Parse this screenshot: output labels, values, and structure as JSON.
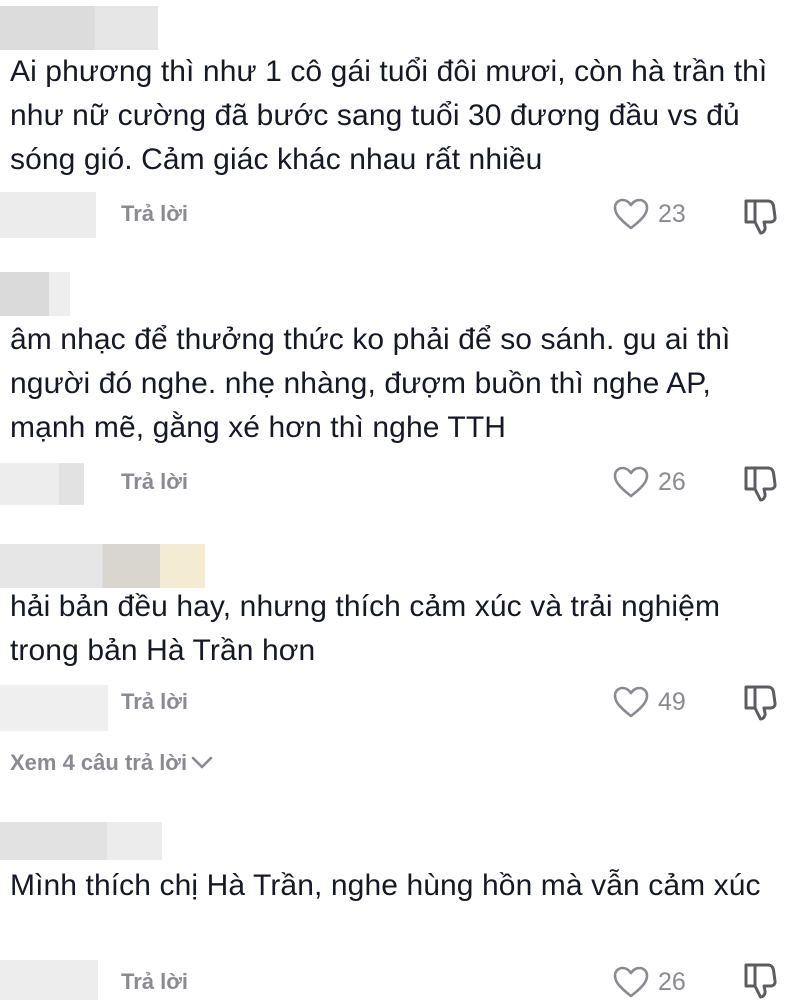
{
  "comments": [
    {
      "text": "Ai phương thì như 1 cô gái tuổi đôi mươi, còn hà trần thì như nữ cường đã bước sang tuổi 30 đương đầu vs đủ sóng gió. Cảm giác khác nhau rất nhiều",
      "reply_label": "Trả lời",
      "likes": "23"
    },
    {
      "text": "âm nhạc để thưởng thức ko phải để so sánh. gu ai thì người đó nghe. nhẹ nhàng, đượm buồn thì nghe AP, mạnh mẽ, gằng xé hơn thì nghe TTH",
      "reply_label": "Trả lời",
      "likes": "26"
    },
    {
      "text": "hải bản đều hay, nhưng thích cảm xúc và trải nghiệm trong bản Hà Trần hơn",
      "reply_label": "Trả lời",
      "likes": "49"
    },
    {
      "text": "Mình thích chị Hà Trần, nghe hùng hồn mà vẫn cảm xúc",
      "reply_label": "Trả lời",
      "likes": "26"
    }
  ],
  "view_replies": {
    "label": "Xem 4 câu trả lời"
  },
  "icons": {
    "like": "heart-outline-icon",
    "dislike": "thumbs-down-icon",
    "expand": "chevron-down-icon"
  },
  "colors": {
    "text": "#161823",
    "muted": "#8a8b91",
    "background": "#ffffff"
  }
}
